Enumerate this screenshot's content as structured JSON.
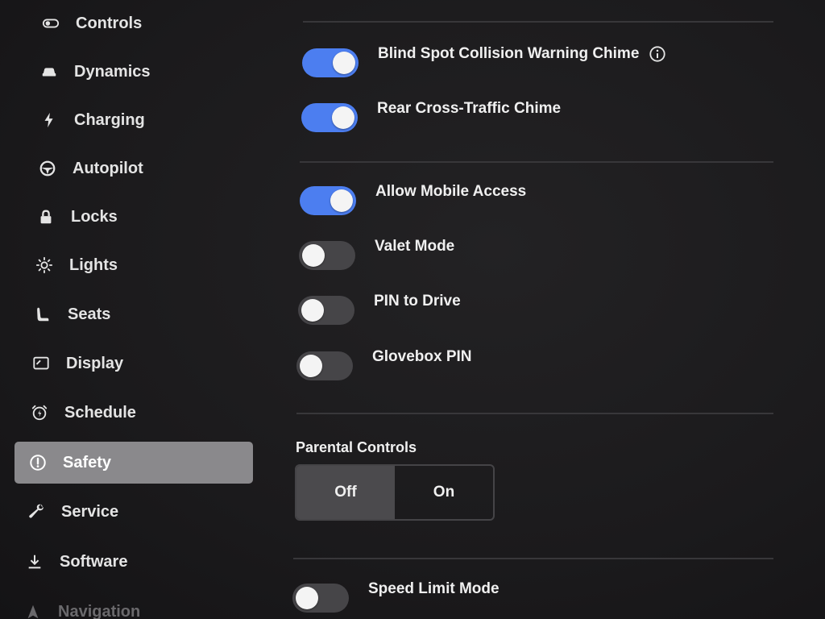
{
  "sidebar": {
    "items": [
      {
        "label": "Controls",
        "icon": "toggle-icon"
      },
      {
        "label": "Dynamics",
        "icon": "car-icon"
      },
      {
        "label": "Charging",
        "icon": "lightning-icon"
      },
      {
        "label": "Autopilot",
        "icon": "steering-wheel-icon"
      },
      {
        "label": "Locks",
        "icon": "lock-icon"
      },
      {
        "label": "Lights",
        "icon": "sun-icon"
      },
      {
        "label": "Seats",
        "icon": "seat-icon"
      },
      {
        "label": "Display",
        "icon": "display-icon"
      },
      {
        "label": "Schedule",
        "icon": "alarm-clock-icon"
      },
      {
        "label": "Safety",
        "icon": "alert-circle-icon",
        "active": true
      },
      {
        "label": "Service",
        "icon": "wrench-icon"
      },
      {
        "label": "Software",
        "icon": "download-icon"
      },
      {
        "label": "Navigation",
        "icon": "navigation-arrow-icon"
      }
    ]
  },
  "settings": {
    "blind_spot": {
      "label": "Blind Spot Collision Warning Chime",
      "on": true
    },
    "rear_cross": {
      "label": "Rear Cross-Traffic Chime",
      "on": true
    },
    "mobile_access": {
      "label": "Allow Mobile Access",
      "on": true
    },
    "valet": {
      "label": "Valet Mode",
      "on": false
    },
    "pin_drive": {
      "label": "PIN to Drive",
      "on": false
    },
    "glovebox": {
      "label": "Glovebox PIN",
      "on": false
    },
    "speed_limit": {
      "label": "Speed Limit Mode",
      "on": false
    }
  },
  "parental_controls": {
    "title": "Parental Controls",
    "options": [
      "Off",
      "On"
    ],
    "selected": "Off"
  },
  "colors": {
    "accent": "#4c7ef0",
    "active_nav": "#8a898c",
    "background": "#1b1a1c"
  }
}
